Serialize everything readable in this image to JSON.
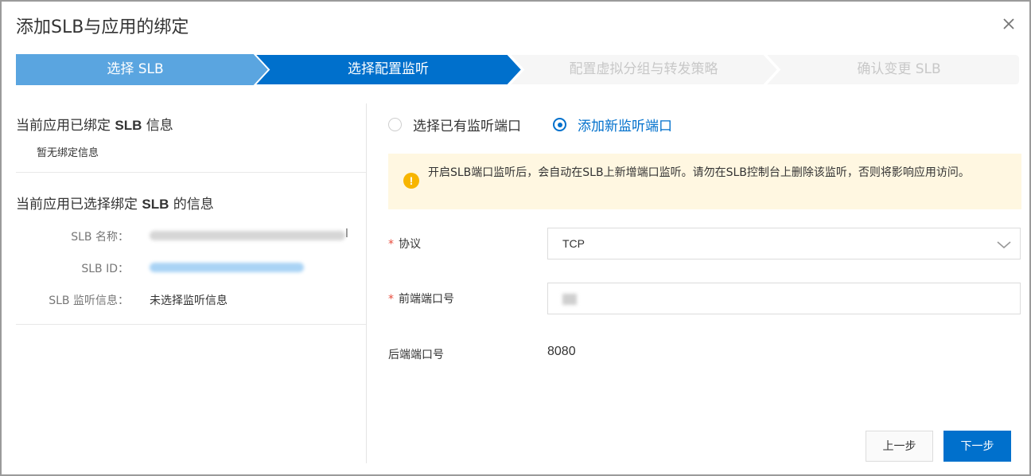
{
  "dialog": {
    "title": "添加SLB与应用的绑定"
  },
  "steps": [
    {
      "label": "选择 SLB",
      "state": "done"
    },
    {
      "label": "选择配置监听",
      "state": "active"
    },
    {
      "label": "配置虚拟分组与转发策略",
      "state": "pending"
    },
    {
      "label": "确认变更 SLB",
      "state": "pending"
    }
  ],
  "left": {
    "bound_title_prefix": "当前应用已绑定 ",
    "bound_title_bold": "SLB",
    "bound_title_suffix": " 信息",
    "bound_empty": "暂无绑定信息",
    "selected_title_prefix": "当前应用已选择绑定 ",
    "selected_title_bold": "SLB",
    "selected_title_suffix": " 的信息",
    "fields": [
      {
        "label": "SLB 名称：",
        "value": "",
        "suffix": "l"
      },
      {
        "label": "SLB ID：",
        "value": "",
        "suffix": ""
      },
      {
        "label": "SLB 监听信息：",
        "value": "未选择监听信息",
        "suffix": ""
      }
    ]
  },
  "right": {
    "radio_existing": "选择已有监听端口",
    "radio_new": "添加新监听端口",
    "selected_radio": "new",
    "alert": "开启SLB端口监听后，会自动在SLB上新增端口监听。请勿在SLB控制台上删除该监听，否则将影响应用访问。",
    "alert_icon": "!",
    "protocol_label": "协议",
    "protocol_value": "TCP",
    "frontend_port_label": "前端端口号",
    "frontend_port_value": "",
    "backend_port_label": "后端端口号",
    "backend_port_value": "8080",
    "required_mark": "*"
  },
  "buttons": {
    "prev": "上一步",
    "next": "下一步"
  },
  "colors": {
    "primary": "#0070cc",
    "done": "#5aa5e0",
    "pending": "#f6f6f6",
    "alert_bg": "#fff7e1",
    "alert_icon": "#f7b500"
  }
}
